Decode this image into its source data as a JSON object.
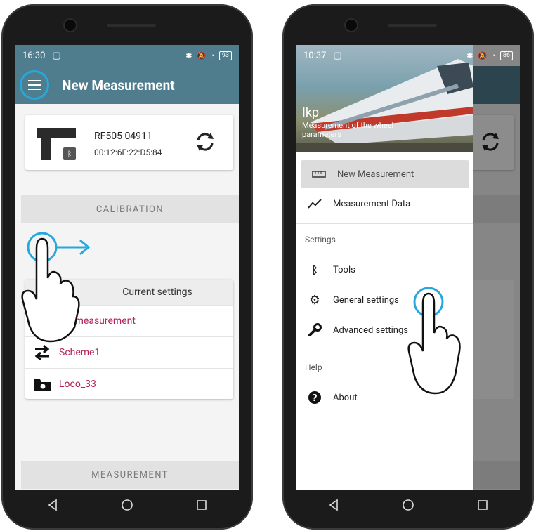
{
  "left_phone": {
    "status": {
      "time": "16:30",
      "battery": "93"
    },
    "appbar": {
      "title": "New Measurement"
    },
    "device": {
      "name": "RF505 04911",
      "mac": "00:12:6F:22:D5:84"
    },
    "calibration_label": "CALIBRATION",
    "settings": {
      "header": "Current settings",
      "items": [
        {
          "label": "Rapid measurement",
          "visible_label": "pid measurement",
          "icon": "speedometer-icon"
        },
        {
          "label": "Scheme1",
          "icon": "swap-icon"
        },
        {
          "label": "Loco_33",
          "icon": "locomotive-icon"
        }
      ]
    },
    "measurement_label": "MEASUREMENT"
  },
  "right_phone": {
    "status": {
      "time": "10:37",
      "battery": "86"
    },
    "drawer": {
      "app_name": "Ikp",
      "app_subtitle": "Measurement of the wheel parameters",
      "items": [
        {
          "label": "New Measurement",
          "icon": "ruler-icon"
        },
        {
          "label": "Measurement Data",
          "icon": "trend-icon"
        }
      ],
      "settings_header": "Settings",
      "settings_items": [
        {
          "label": "Tools",
          "icon": "bluetooth-icon"
        },
        {
          "label": "General settings",
          "icon": "gear-icon"
        },
        {
          "label": "Advanced settings",
          "icon": "wrench-icon"
        }
      ],
      "help_header": "Help",
      "help_items": [
        {
          "label": "About",
          "icon": "help-icon"
        }
      ]
    }
  },
  "colors": {
    "appbar": "#4f7d8e",
    "accent": "#b3225a",
    "highlight": "#27a8dc"
  }
}
